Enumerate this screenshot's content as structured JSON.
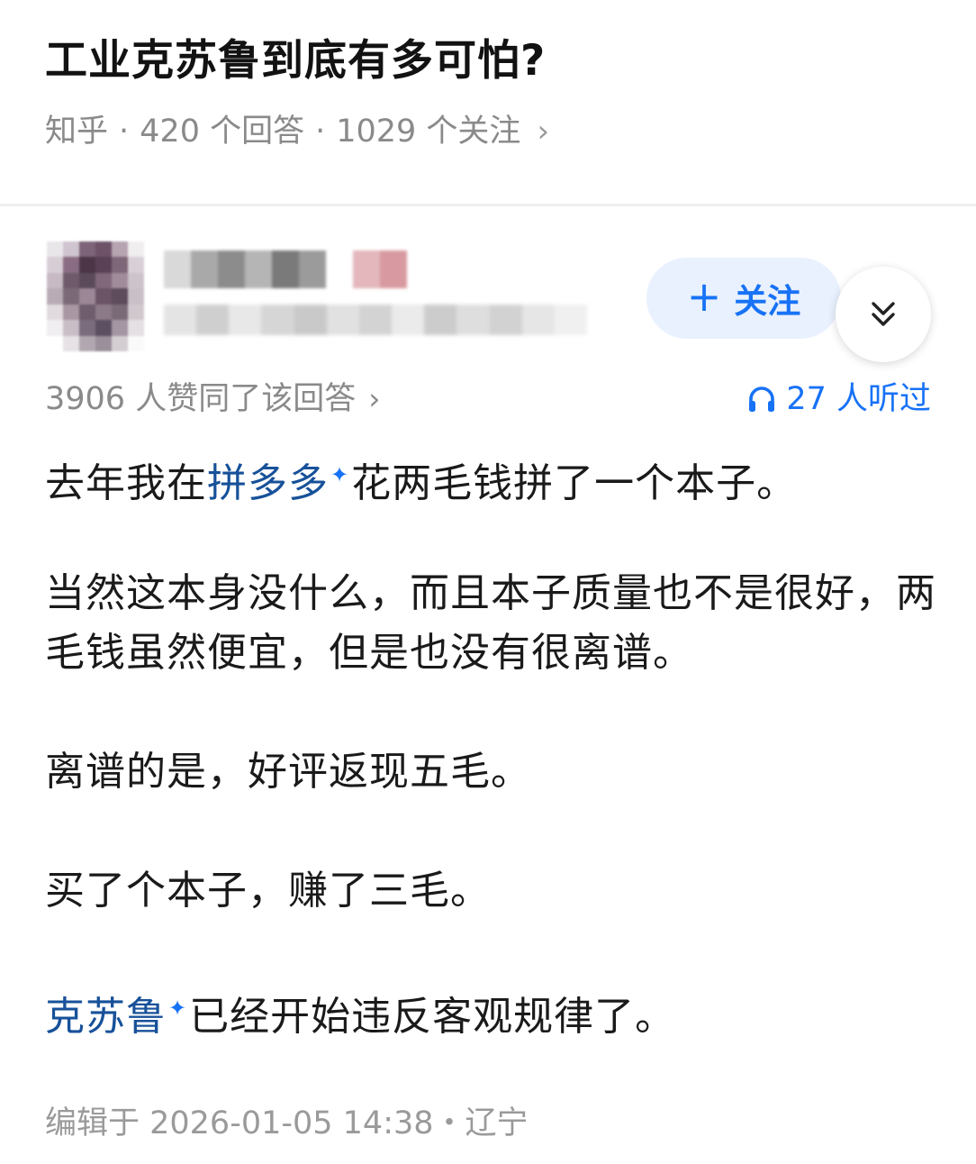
{
  "question": {
    "title": "工业克苏鲁到底有多可怕?",
    "source": "知乎",
    "answers": "420 个回答",
    "followers": "1029 个关注",
    "separator": "·",
    "chevron": "›"
  },
  "author": {
    "follow_plus": "+",
    "follow_label": "关注",
    "collapse_icon": "double-chevron-down-icon"
  },
  "stats": {
    "votes": "3906 人赞同了该回答",
    "votes_chevron": "›",
    "listen_icon": "headphones-icon",
    "listens": "27 人听过"
  },
  "answer": {
    "p1_before": "去年我在",
    "p1_link": "拼多多",
    "p1_after": "花两毛钱拼了一个本子。",
    "p2": "当然这本身没什么，而且本子质量也不是很好，两毛钱虽然便宜，但是也没有很离谱。",
    "p3": "离谱的是，好评返现五毛。",
    "p4": "买了个本子，赚了三毛。",
    "p5_link": "克苏鲁",
    "p5_after": "已经开始违反客观规律了。",
    "spark": "✦"
  },
  "footer": {
    "edit_info": "编辑于 2026-01-05 14:38・辽宁"
  },
  "colors": {
    "accent": "#1772f6",
    "link": "#175199",
    "meta_gray": "#8a8a8a",
    "follow_bg": "#e9f1fe"
  }
}
